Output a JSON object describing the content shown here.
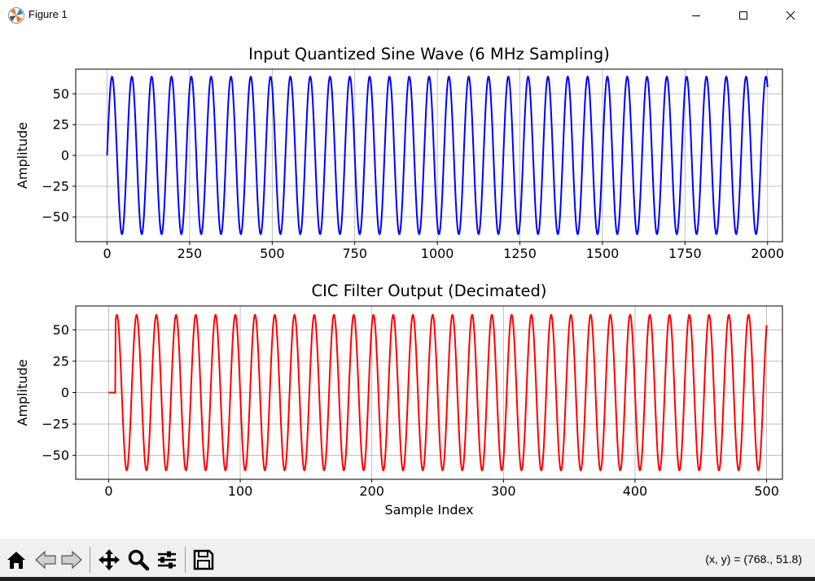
{
  "window": {
    "title": "Figure 1"
  },
  "toolbar": {
    "buttons": [
      "home-icon",
      "back-arrow-icon",
      "forward-arrow-icon",
      "pan-icon",
      "zoom-icon",
      "configure-subplots-icon",
      "save-icon"
    ],
    "coords_text": "(x, y) = (768., 51.8)"
  },
  "chart_data": [
    {
      "type": "line",
      "title": "Input Quantized Sine Wave (6 MHz Sampling)",
      "xlabel": "",
      "ylabel": "Amplitude",
      "xlim": [
        -95,
        2045
      ],
      "ylim": [
        -70,
        70
      ],
      "xticks": [
        0,
        250,
        500,
        750,
        1000,
        1250,
        1500,
        1750,
        2000
      ],
      "xtick_labels": [
        "0",
        "250",
        "500",
        "750",
        "1000",
        "1250",
        "1500",
        "1750",
        "2000"
      ],
      "yticks": [
        50,
        25,
        0,
        -25,
        -50
      ],
      "ytick_labels": [
        "50",
        "25",
        "0",
        "−25",
        "−50"
      ],
      "grid": true,
      "series": [
        {
          "color": "#0000ff",
          "x_start": 0,
          "x_end": 2000,
          "amplitude": 64,
          "period": 60,
          "phase_offset": 0
        }
      ]
    },
    {
      "type": "line",
      "title": "CIC Filter Output (Decimated)",
      "xlabel": "Sample Index",
      "ylabel": "Amplitude",
      "xlim": [
        -25,
        512
      ],
      "ylim": [
        -69,
        69
      ],
      "xticks": [
        0,
        100,
        200,
        300,
        400,
        500
      ],
      "xtick_labels": [
        "0",
        "100",
        "200",
        "300",
        "400",
        "500"
      ],
      "yticks": [
        50,
        25,
        0,
        -25,
        -50
      ],
      "ytick_labels": [
        "50",
        "25",
        "0",
        "−25",
        "−50"
      ],
      "grid": true,
      "series": [
        {
          "color": "#ff0000",
          "x_start": 0,
          "x_end": 500,
          "amplitude": 62,
          "period": 15,
          "zero_until": 5,
          "phase_offset": 6.25
        }
      ]
    }
  ]
}
